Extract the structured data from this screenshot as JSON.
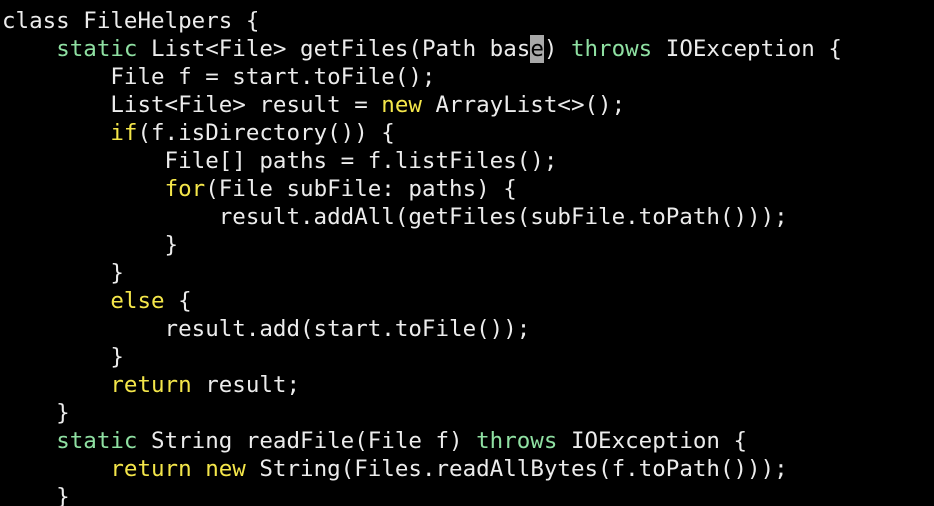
{
  "colors": {
    "background": "#000000",
    "plain": "#ececec",
    "modifier": "#8fe0a2",
    "keyword": "#f4e64a",
    "cursor_bg": "#a8a8a8",
    "cursor_fg": "#000000"
  },
  "cursor": {
    "line": 1,
    "token": 3,
    "char": 3
  },
  "lines": [
    [
      {
        "t": "class FileHelpers {",
        "k": "plain"
      }
    ],
    [
      {
        "t": "    ",
        "k": "plain"
      },
      {
        "t": "static",
        "k": "modifier"
      },
      {
        "t": " List<File> getFiles(Path ",
        "k": "plain"
      },
      {
        "t": "base",
        "k": "plain"
      },
      {
        "t": ") ",
        "k": "plain"
      },
      {
        "t": "throws",
        "k": "modifier"
      },
      {
        "t": " IOException {",
        "k": "plain"
      }
    ],
    [
      {
        "t": "        File f = start.toFile();",
        "k": "plain"
      }
    ],
    [
      {
        "t": "        List<File> result = ",
        "k": "plain"
      },
      {
        "t": "new",
        "k": "keyword"
      },
      {
        "t": " ArrayList<>();",
        "k": "plain"
      }
    ],
    [
      {
        "t": "        ",
        "k": "plain"
      },
      {
        "t": "if",
        "k": "keyword"
      },
      {
        "t": "(f.isDirectory()) {",
        "k": "plain"
      }
    ],
    [
      {
        "t": "            File[] paths = f.listFiles();",
        "k": "plain"
      }
    ],
    [
      {
        "t": "            ",
        "k": "plain"
      },
      {
        "t": "for",
        "k": "keyword"
      },
      {
        "t": "(File subFile: paths) {",
        "k": "plain"
      }
    ],
    [
      {
        "t": "                result.addAll(getFiles(subFile.toPath()));",
        "k": "plain"
      }
    ],
    [
      {
        "t": "            }",
        "k": "plain"
      }
    ],
    [
      {
        "t": "        }",
        "k": "plain"
      }
    ],
    [
      {
        "t": "        ",
        "k": "plain"
      },
      {
        "t": "else",
        "k": "keyword"
      },
      {
        "t": " {",
        "k": "plain"
      }
    ],
    [
      {
        "t": "            result.add(start.toFile());",
        "k": "plain"
      }
    ],
    [
      {
        "t": "        }",
        "k": "plain"
      }
    ],
    [
      {
        "t": "        ",
        "k": "plain"
      },
      {
        "t": "return",
        "k": "keyword"
      },
      {
        "t": " result;",
        "k": "plain"
      }
    ],
    [
      {
        "t": "    }",
        "k": "plain"
      }
    ],
    [
      {
        "t": "    ",
        "k": "plain"
      },
      {
        "t": "static",
        "k": "modifier"
      },
      {
        "t": " String readFile(File f) ",
        "k": "plain"
      },
      {
        "t": "throws",
        "k": "modifier"
      },
      {
        "t": " IOException {",
        "k": "plain"
      }
    ],
    [
      {
        "t": "        ",
        "k": "plain"
      },
      {
        "t": "return",
        "k": "keyword"
      },
      {
        "t": " ",
        "k": "plain"
      },
      {
        "t": "new",
        "k": "keyword"
      },
      {
        "t": " String(Files.readAllBytes(f.toPath()));",
        "k": "plain"
      }
    ],
    [
      {
        "t": "    }",
        "k": "plain"
      }
    ]
  ]
}
